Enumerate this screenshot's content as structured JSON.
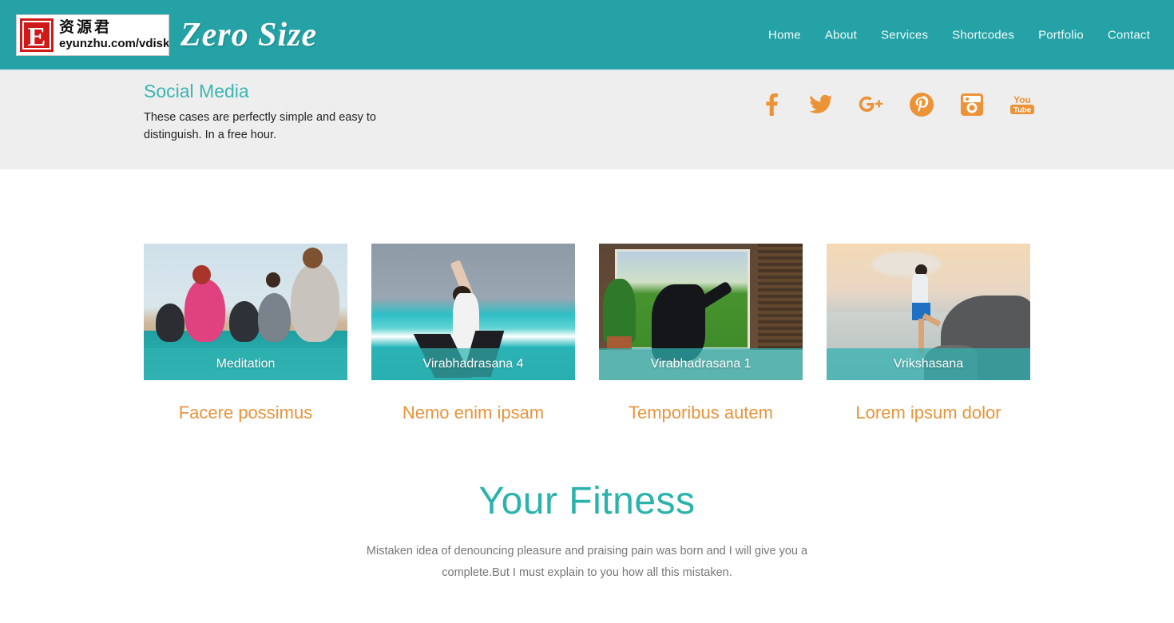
{
  "header": {
    "logo": {
      "letter": "E",
      "chinese": "资源君",
      "url": "eyunzhu.com/vdisk"
    },
    "site_title": "Zero Size",
    "background_color": "#24a2a6",
    "nav": [
      {
        "label": "Home"
      },
      {
        "label": "About"
      },
      {
        "label": "Services"
      },
      {
        "label": "Shortcodes"
      },
      {
        "label": "Portfolio"
      },
      {
        "label": "Contact"
      }
    ]
  },
  "social_bar": {
    "background_color": "#eeeeee",
    "title": "Social Media",
    "title_color": "#3bb5b0",
    "description": "These cases are perfectly simple and easy to distinguish. In a free hour.",
    "icon_color": "#ed9337",
    "icons": [
      {
        "name": "facebook-icon"
      },
      {
        "name": "twitter-icon"
      },
      {
        "name": "google-plus-icon"
      },
      {
        "name": "pinterest-icon"
      },
      {
        "name": "instagram-icon"
      },
      {
        "name": "youtube-icon"
      }
    ]
  },
  "cards": {
    "label_color": "#e8943a",
    "caption_color": "#2fb1b2",
    "items": [
      {
        "caption": "Meditation",
        "label": "Facere possimus"
      },
      {
        "caption": "Virabhadrasana 4",
        "label": "Nemo enim ipsam"
      },
      {
        "caption": "Virabhadrasana 1",
        "label": "Temporibus autem"
      },
      {
        "caption": "Vrikshasana",
        "label": "Lorem ipsum dolor"
      }
    ]
  },
  "fitness": {
    "heading": "Your Fitness",
    "heading_color": "#2ab3ab",
    "paragraph": "Mistaken idea of denouncing pleasure and praising pain was born and I will give you a complete.But I must explain to you how all this mistaken."
  }
}
